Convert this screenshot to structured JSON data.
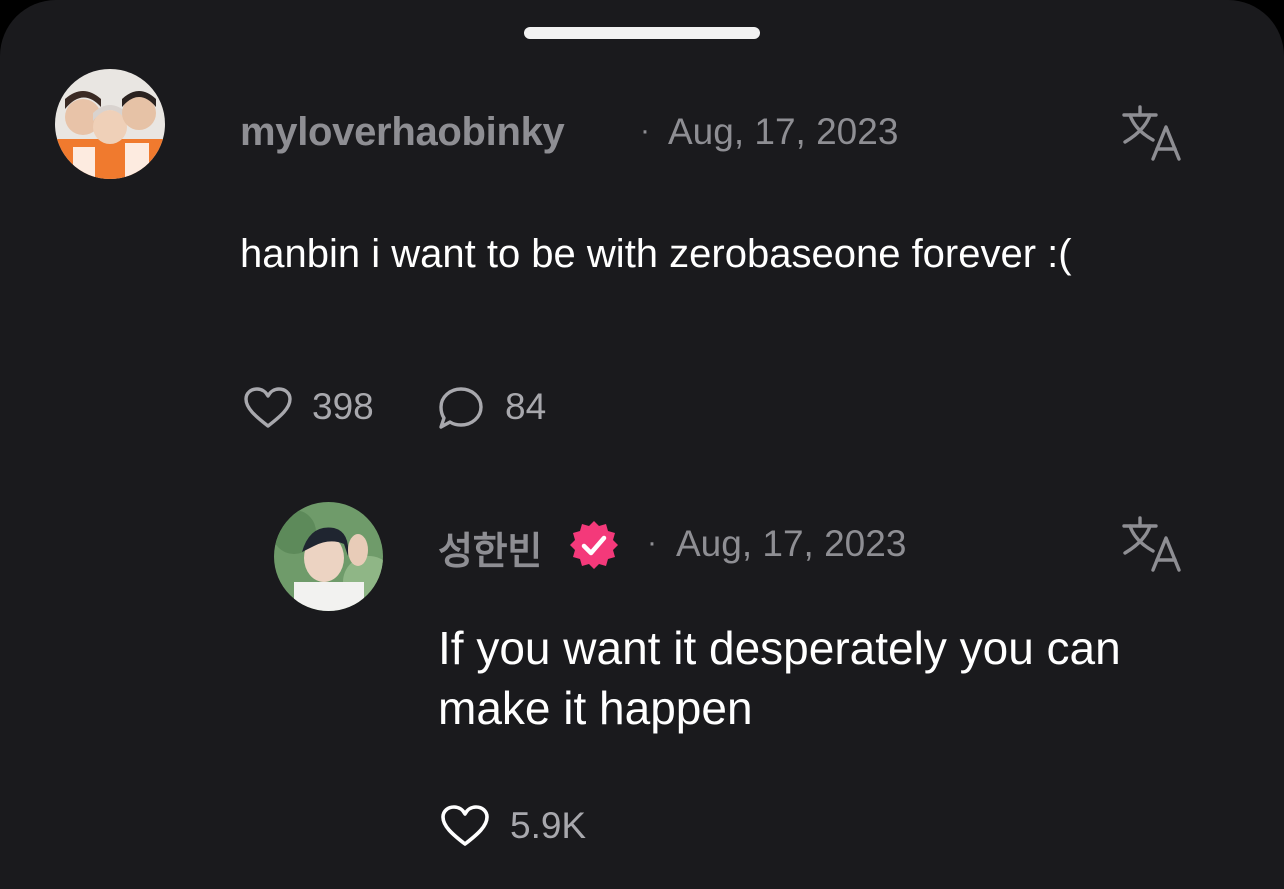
{
  "comment": {
    "username": "myloverhaobinky",
    "separator": "·",
    "date": "Aug, 17, 2023",
    "text": "hanbin i want to be with zerobaseone forever :(",
    "likes": "398",
    "replies": "84",
    "avatar_icon": "avatar-photo-icon",
    "translate_icon": "translate-icon"
  },
  "reply": {
    "username": "성한빈",
    "verified": true,
    "separator": "·",
    "date": "Aug, 17, 2023",
    "text": "If you want it desperately you can make it happen",
    "likes": "5.9K",
    "avatar_icon": "avatar-photo-icon",
    "translate_icon": "translate-icon"
  },
  "colors": {
    "background": "#1a1a1d",
    "muted_text": "#8e8e93",
    "primary_text": "#ffffff",
    "verified_badge": "#f4397a"
  }
}
